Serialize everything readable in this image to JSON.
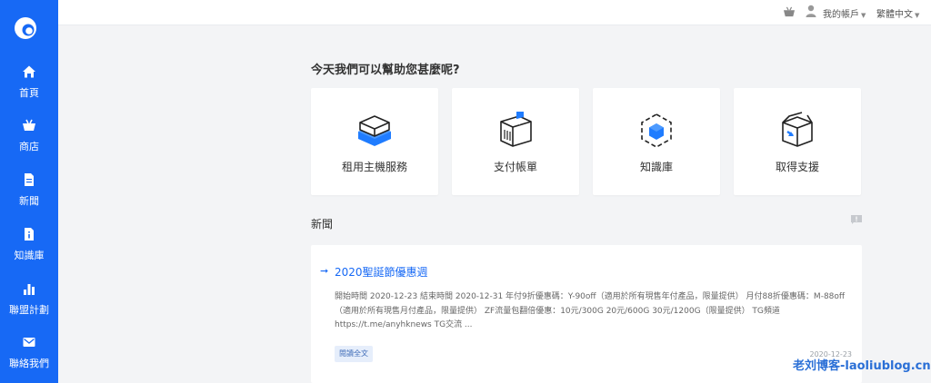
{
  "sidebar": {
    "items": [
      {
        "label": "首頁",
        "icon": "home-icon"
      },
      {
        "label": "商店",
        "icon": "basket-icon"
      },
      {
        "label": "新聞",
        "icon": "document-icon"
      },
      {
        "label": "知識庫",
        "icon": "info-document-icon"
      },
      {
        "label": "聯盟計劃",
        "icon": "bar-chart-icon"
      },
      {
        "label": "聯絡我們",
        "icon": "mail-icon"
      }
    ]
  },
  "topbar": {
    "account_label": "我的帳戶",
    "language_label": "繁體中文"
  },
  "main": {
    "heading": "今天我們可以幫助您甚麼呢?",
    "cards": [
      {
        "label": "租用主機服務",
        "icon": "server-box-icon"
      },
      {
        "label": "支付帳單",
        "icon": "invoice-box-icon"
      },
      {
        "label": "知識庫",
        "icon": "knowledge-cube-icon"
      },
      {
        "label": "取得支援",
        "icon": "support-box-icon"
      }
    ],
    "news_section_title": "新聞",
    "news": {
      "title": "2020聖誕節優惠週",
      "body": "開始時間 2020-12-23 結束時間 2020-12-31   年付9折優惠碼：Y-90off（適用於所有現售年付產品，限量提供）  月付88折優惠碼：M-88off（適用於所有現售月付產品，限量提供）  ZF流量包翻倍優惠：10元/300G 20元/600G 30元/1200G（限量提供）   TG頻道 https://t.me/anyhknews TG交流 ...",
      "read_more_label": "閱讀全文",
      "date": "2020-12-23"
    }
  },
  "watermark": "老刘博客-laoliublog.cn",
  "colors": {
    "accent": "#1769f5",
    "background": "#f3f4f6"
  }
}
